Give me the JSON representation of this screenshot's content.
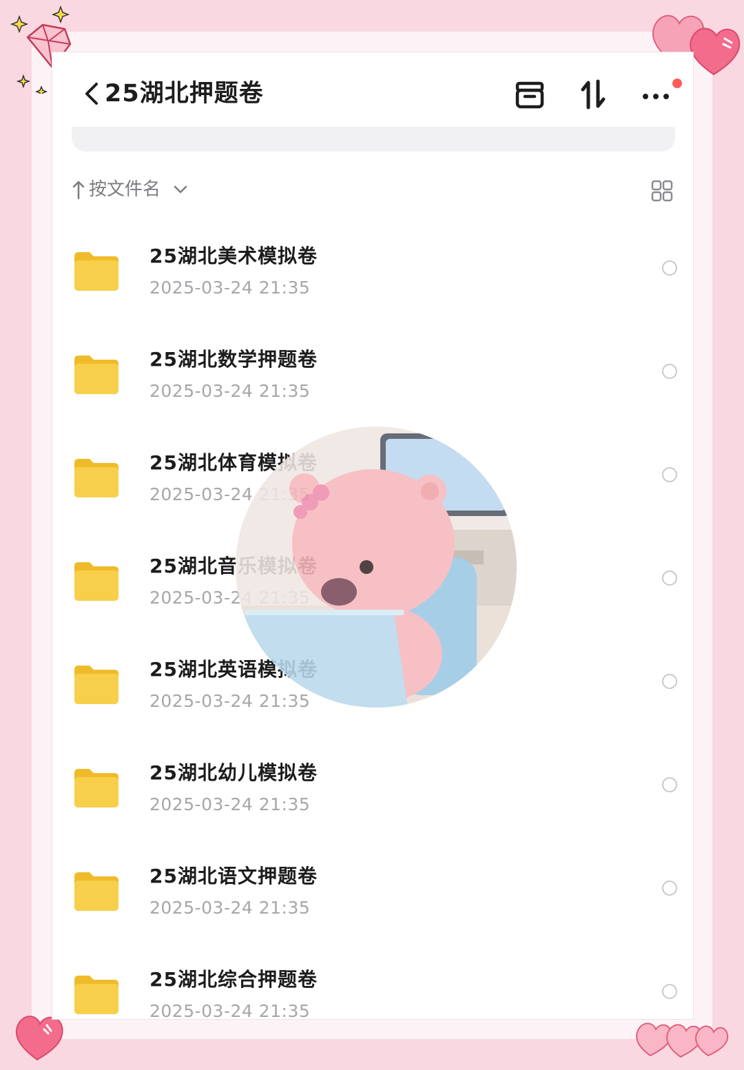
{
  "app": {
    "title": "25湖北押题卷",
    "sort_label": "按文件名",
    "accent_color": "#f7c842",
    "notification_dot_color": "#ff5b5b"
  },
  "toolbar": {
    "icons": [
      "back-chevron-icon",
      "box-icon",
      "sort-icon",
      "more-icon",
      "grid-view-icon"
    ]
  },
  "files": [
    {
      "name": "25湖北美术模拟卷",
      "date": "2025-03-24 21:35"
    },
    {
      "name": "25湖北数学押题卷",
      "date": "2025-03-24 21:35"
    },
    {
      "name": "25湖北体育模拟卷",
      "date": "2025-03-24 21:35"
    },
    {
      "name": "25湖北音乐模拟卷",
      "date": "2025-03-24 21:35"
    },
    {
      "name": "25湖北英语模拟卷",
      "date": "2025-03-24 21:35"
    },
    {
      "name": "25湖北幼儿模拟卷",
      "date": "2025-03-24 21:35"
    },
    {
      "name": "25湖北语文押题卷",
      "date": "2025-03-24 21:35"
    },
    {
      "name": "25湖北综合押题卷",
      "date": "2025-03-24 21:35"
    }
  ]
}
